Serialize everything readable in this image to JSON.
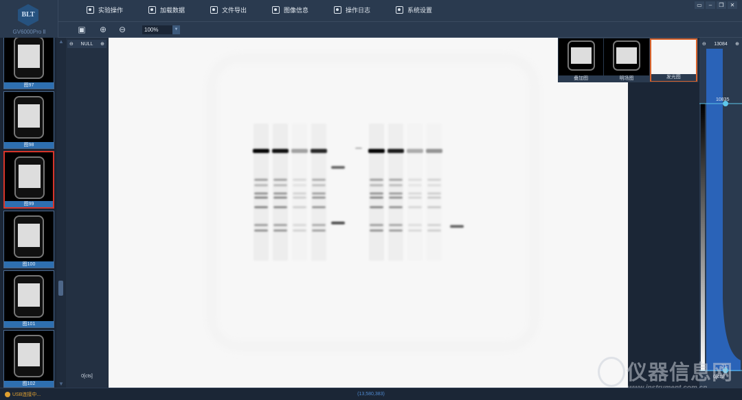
{
  "app": {
    "logo_text": "BLT",
    "model": "GV6000Pro Ⅱ"
  },
  "menu": [
    {
      "label": "实验操作",
      "icon": "camera-icon"
    },
    {
      "label": "加载数据",
      "icon": "load-data-icon"
    },
    {
      "label": "文件导出",
      "icon": "file-export-icon"
    },
    {
      "label": "图像信息",
      "icon": "image-info-icon"
    },
    {
      "label": "操作日志",
      "icon": "log-icon"
    },
    {
      "label": "系统设置",
      "icon": "settings-icon"
    }
  ],
  "toolbar": {
    "zoom_value": "100%",
    "buttons": [
      "save-icon",
      "zoom-in-icon",
      "zoom-out-icon"
    ]
  },
  "window_buttons": [
    "restore-to-tray",
    "minimize",
    "maximize",
    "close"
  ],
  "thumbnails": [
    {
      "label": "图97",
      "selected": false
    },
    {
      "label": "图98",
      "selected": false
    },
    {
      "label": "图99",
      "selected": true
    },
    {
      "label": "图100",
      "selected": false
    },
    {
      "label": "图101",
      "selected": false
    },
    {
      "label": "图102",
      "selected": false
    }
  ],
  "left_panel": {
    "title": "NULL",
    "unit": "0[cts]"
  },
  "views": [
    {
      "label": "叠加图",
      "selected": false
    },
    {
      "label": "明场图",
      "selected": false
    },
    {
      "label": "发光图",
      "selected": true
    }
  ],
  "histogram": {
    "max": "13084",
    "upper": "10835",
    "lower": "31",
    "unit": "0[cts]",
    "color": "#2a63b8"
  },
  "status": {
    "connection": "USB连接中...",
    "coordinates": "(13,580,383)"
  },
  "watermark": {
    "text": "仪器信息网",
    "url": "www.instrument.com.cn"
  },
  "colors": {
    "selected_thumbnail": "#d8352a",
    "selected_view": "#d9622a",
    "accent": "#2e6fb0"
  }
}
